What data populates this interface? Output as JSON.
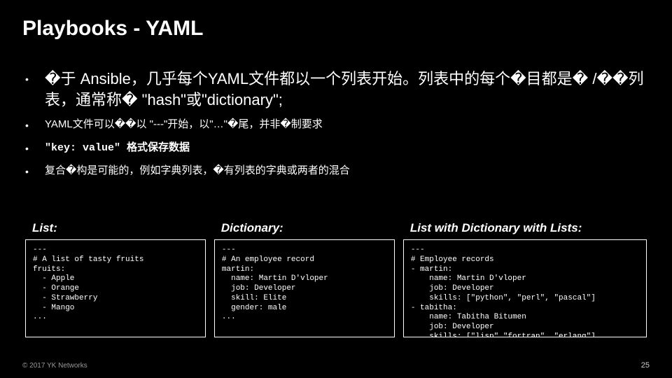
{
  "title": "Playbooks - YAML",
  "bullets": [
    "�于 Ansible，几乎每个YAML文件都以一个列表开始。列表中的每个�目都是� /��列表，通常称� \"hash\"或\"dictionary\";",
    "YAML文件可以��以 \"---\"开始，以\"…\"�尾，并非�制要求",
    "\"key: value\" 格式保存数据",
    "复合�构是可能的，例如字典列表，�有列表的字典或两者的混合"
  ],
  "columns": [
    {
      "heading": "List:",
      "code": "---\n# A list of tasty fruits\nfruits:\n  - Apple\n  - Orange\n  - Strawberry\n  - Mango\n..."
    },
    {
      "heading": "Dictionary:",
      "code": "---\n# An employee record\nmartin:\n  name: Martin D'vloper\n  job: Developer\n  skill: Elite\n  gender: male\n..."
    },
    {
      "heading": "List with Dictionary with Lists:",
      "code": "---\n# Employee records\n- martin:\n    name: Martin D'vloper\n    job: Developer\n    skills: [\"python\", \"perl\", \"pascal\"]\n- tabitha:\n    name: Tabitha Bitumen\n    job: Developer\n    skills: [\"lisp\",\"fortran\", \"erlang\"]\n..."
    }
  ],
  "footer": {
    "copyright": "© 2017 YK Networks",
    "page": "25"
  }
}
